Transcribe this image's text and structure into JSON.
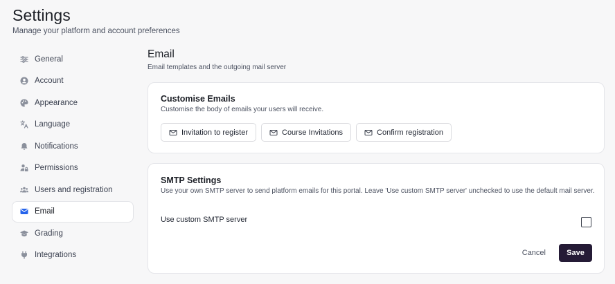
{
  "header": {
    "title": "Settings",
    "subtitle": "Manage your platform and account preferences"
  },
  "sidebar": {
    "active": "Email",
    "items": [
      {
        "label": "General",
        "icon": "sliders-icon"
      },
      {
        "label": "Account",
        "icon": "user-circle-icon"
      },
      {
        "label": "Appearance",
        "icon": "palette-icon"
      },
      {
        "label": "Language",
        "icon": "translate-icon"
      },
      {
        "label": "Notifications",
        "icon": "bell-icon"
      },
      {
        "label": "Permissions",
        "icon": "user-lock-icon"
      },
      {
        "label": "Users and registration",
        "icon": "users-icon"
      },
      {
        "label": "Email",
        "icon": "envelope-icon"
      },
      {
        "label": "Grading",
        "icon": "graduation-cap-icon"
      },
      {
        "label": "Integrations",
        "icon": "plug-icon"
      }
    ]
  },
  "main": {
    "title": "Email",
    "subtitle": "Email templates and the outgoing mail server",
    "customise": {
      "title": "Customise Emails",
      "description": "Customise the body of emails your users will receive.",
      "templates": [
        {
          "label": "Invitation to register"
        },
        {
          "label": "Course Invitations"
        },
        {
          "label": "Confirm registration"
        }
      ]
    },
    "smtp": {
      "title": "SMTP Settings",
      "description": "Use your own SMTP server to send platform emails for this portal. Leave 'Use custom SMTP server' unchecked to use the default mail server.",
      "toggle_label": "Use custom SMTP server",
      "checked": false,
      "cancel_label": "Cancel",
      "save_label": "Save"
    }
  },
  "colors": {
    "accent": "#2563eb",
    "icon": "#8b909c",
    "primary_button": "#251b36"
  }
}
